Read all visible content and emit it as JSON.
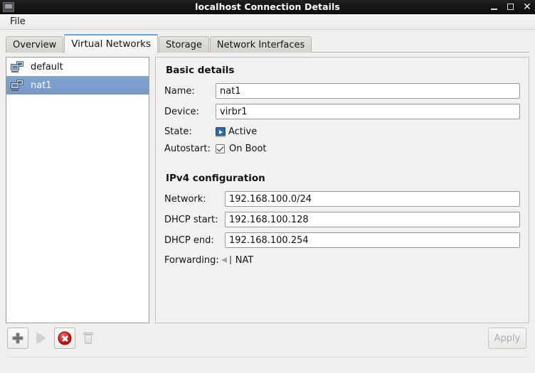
{
  "window": {
    "title": "localhost Connection Details",
    "icon": "app-icon",
    "controls": {
      "minimize": "–",
      "maximize": "□",
      "close": "✕"
    }
  },
  "menubar": {
    "items": [
      {
        "label": "File"
      }
    ]
  },
  "tabs": [
    {
      "label": "Overview",
      "active": false
    },
    {
      "label": "Virtual Networks",
      "active": true
    },
    {
      "label": "Storage",
      "active": false
    },
    {
      "label": "Network Interfaces",
      "active": false
    }
  ],
  "network_list": [
    {
      "name": "default",
      "selected": false,
      "icon": "network-icon"
    },
    {
      "name": "nat1",
      "selected": true,
      "icon": "network-icon"
    }
  ],
  "details": {
    "basic": {
      "title": "Basic details",
      "name_label": "Name:",
      "name_value": "nat1",
      "device_label": "Device:",
      "device_value": "virbr1",
      "state_label": "State:",
      "state_value": "Active",
      "state_icon": "active-state-icon",
      "autostart_label": "Autostart:",
      "autostart_value": "On Boot",
      "autostart_checked": true
    },
    "ipv4": {
      "title": "IPv4 configuration",
      "network_label": "Network:",
      "network_value": "192.168.100.0/24",
      "dhcp_start_label": "DHCP start:",
      "dhcp_start_value": "192.168.100.128",
      "dhcp_end_label": "DHCP end:",
      "dhcp_end_value": "192.168.100.254",
      "forwarding_label": "Forwarding:",
      "forwarding_value": "NAT",
      "forwarding_icon": "forward-nat-icon"
    }
  },
  "toolbar": {
    "add": {
      "name": "add-network-button",
      "icon": "plus-icon",
      "enabled": true
    },
    "start": {
      "name": "start-network-button",
      "icon": "play-icon",
      "enabled": false
    },
    "stop": {
      "name": "stop-network-button",
      "icon": "stop-icon",
      "enabled": true
    },
    "delete": {
      "name": "delete-network-button",
      "icon": "trash-icon",
      "enabled": false
    },
    "apply_label": "Apply",
    "apply_enabled": false
  },
  "colors": {
    "titlebar_bg": "#17140f",
    "selection_blue": "#7498c8",
    "tab_accent": "#6aa5d8",
    "panel_bg": "#f2f1ef",
    "stop_red": "#d01818"
  }
}
